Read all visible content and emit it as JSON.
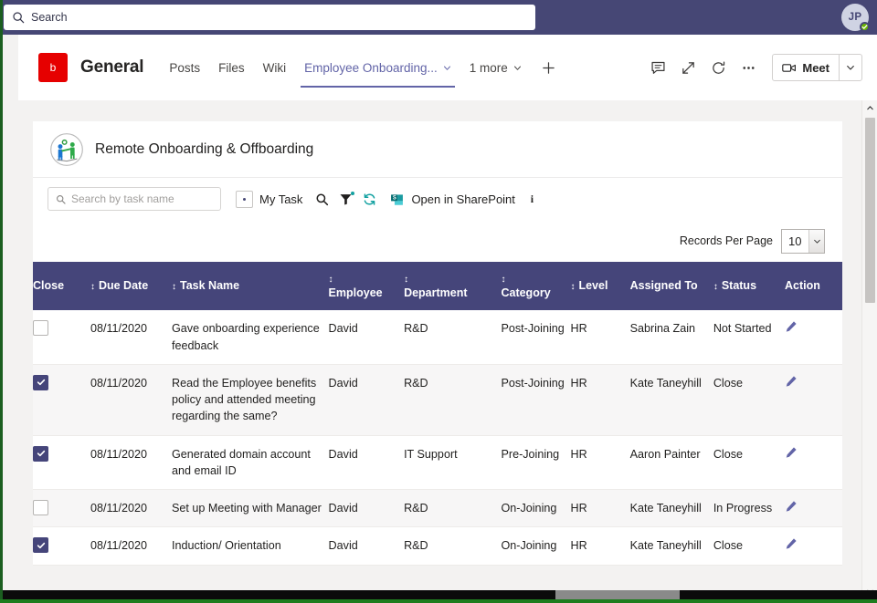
{
  "teams": {
    "search": {
      "placeholder": "Search",
      "icon": "search-icon"
    },
    "avatar": {
      "initials": "JP",
      "presence": "available"
    }
  },
  "channel": {
    "team_initial": "b",
    "title": "General",
    "tabs": [
      {
        "label": "Posts",
        "active": false,
        "has_chevron": false
      },
      {
        "label": "Files",
        "active": false,
        "has_chevron": false
      },
      {
        "label": "Wiki",
        "active": false,
        "has_chevron": false
      },
      {
        "label": "Employee Onboarding...",
        "active": true,
        "has_chevron": true
      },
      {
        "label": "1 more",
        "active": false,
        "has_chevron": true
      }
    ],
    "add_tab_label": "+",
    "actions": [
      {
        "name": "chat-icon",
        "label": "Chat"
      },
      {
        "name": "expand-icon",
        "label": "Expand"
      },
      {
        "name": "refresh-icon",
        "label": "Reload"
      },
      {
        "name": "more-options-icon",
        "label": "More options"
      }
    ],
    "meet": {
      "label": "Meet",
      "caret": "chevron-down-icon"
    }
  },
  "app": {
    "title": "Remote Onboarding & Offboarding",
    "logo": "onboarding-handshake-icon",
    "toolbar": {
      "search_placeholder": "Search by task name",
      "my_task_label": "My Task",
      "icons": [
        {
          "name": "search-icon",
          "label": "Search"
        },
        {
          "name": "filter-icon",
          "label": "Filter"
        },
        {
          "name": "refresh-icon",
          "label": "Refresh"
        }
      ],
      "sharepoint_label": "Open in SharePoint",
      "info_label": "i"
    },
    "records_per_page": {
      "label": "Records Per Page",
      "value": "10"
    }
  },
  "table": {
    "columns": [
      {
        "key": "close",
        "label": "Close",
        "sortable": false
      },
      {
        "key": "due_date",
        "label": "Due Date",
        "sortable": true
      },
      {
        "key": "task_name",
        "label": "Task Name",
        "sortable": true
      },
      {
        "key": "employee",
        "label": "Employee",
        "sortable": true
      },
      {
        "key": "department",
        "label": "Department",
        "sortable": true
      },
      {
        "key": "category",
        "label": "Category",
        "sortable": true
      },
      {
        "key": "level",
        "label": "Level",
        "sortable": true
      },
      {
        "key": "assigned_to",
        "label": "Assigned To",
        "sortable": false
      },
      {
        "key": "status",
        "label": "Status",
        "sortable": true
      },
      {
        "key": "action",
        "label": "Action",
        "sortable": false
      }
    ],
    "sort_glyph": "↕",
    "rows": [
      {
        "checked": false,
        "due_date": "08/11/2020",
        "task_name": "Gave onboarding experience feedback",
        "employee": "David",
        "department": "R&D",
        "category": "Post-Joining",
        "level": "HR",
        "assigned_to": "Sabrina Zain",
        "status": "Not Started",
        "action": "edit-icon"
      },
      {
        "checked": true,
        "due_date": "08/11/2020",
        "task_name": "Read the Employee benefits policy and attended meeting regarding the same?",
        "employee": "David",
        "department": "R&D",
        "category": "Post-Joining",
        "level": "HR",
        "assigned_to": "Kate Taneyhill",
        "status": "Close",
        "action": "edit-icon"
      },
      {
        "checked": true,
        "due_date": "08/11/2020",
        "task_name": "Generated domain account and email ID",
        "employee": "David",
        "department": "IT Support",
        "category": "Pre-Joining",
        "level": "HR",
        "assigned_to": "Aaron Painter",
        "status": "Close",
        "action": "edit-icon"
      },
      {
        "checked": false,
        "due_date": "08/11/2020",
        "task_name": "Set up Meeting with Manager",
        "employee": "David",
        "department": "R&D",
        "category": "On-Joining",
        "level": "HR",
        "assigned_to": "Kate Taneyhill",
        "status": "In Progress",
        "action": "edit-icon"
      },
      {
        "checked": true,
        "due_date": "08/11/2020",
        "task_name": "Induction/ Orientation",
        "employee": "David",
        "department": "R&D",
        "category": "On-Joining",
        "level": "HR",
        "assigned_to": "Kate Taneyhill",
        "status": "Close",
        "action": "edit-icon"
      }
    ]
  },
  "colors": {
    "teams_purple": "#464775",
    "table_header": "#45457a",
    "accent": "#6264a7",
    "due_date_red": "#e03b3b",
    "team_badge_red": "#e60000"
  }
}
